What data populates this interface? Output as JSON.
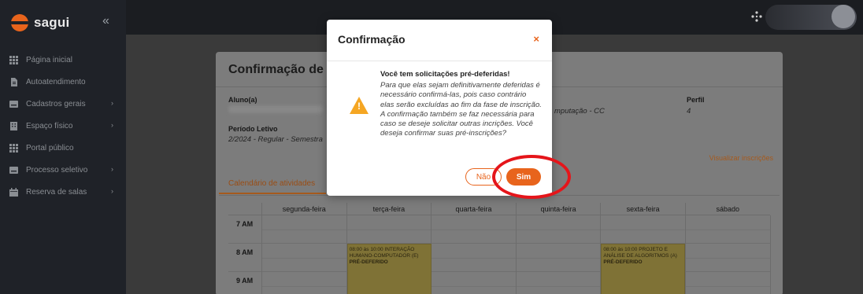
{
  "app": {
    "brand": "sagui"
  },
  "sidebar": {
    "collapse_glyph": "«",
    "items": [
      {
        "label": "Página inicial",
        "icon": "grid-icon",
        "has_chevron": false
      },
      {
        "label": "Autoatendimento",
        "icon": "document-icon",
        "has_chevron": false
      },
      {
        "label": "Cadastros gerais",
        "icon": "card-icon",
        "has_chevron": true
      },
      {
        "label": "Espaço físico",
        "icon": "building-icon",
        "has_chevron": true
      },
      {
        "label": "Portal público",
        "icon": "grid-icon",
        "has_chevron": false
      },
      {
        "label": "Processo seletivo",
        "icon": "card-icon",
        "has_chevron": true
      },
      {
        "label": "Reserva de salas",
        "icon": "calendar-icon",
        "has_chevron": true
      }
    ]
  },
  "topbar": {
    "icons": [
      "network-icon",
      "chart-icon"
    ]
  },
  "page": {
    "title": "Confirmação de sol",
    "aluno_label": "Aluno(a)",
    "curso_value": "mputação - CC",
    "perfil_label": "Perfil",
    "perfil_value": "4",
    "periodo_label": "Período Letivo",
    "periodo_value": "2/2024 - Regular - Semestra",
    "link": "Visualizar inscrições",
    "tab": "Calendário de atividades"
  },
  "calendar": {
    "days": [
      "segunda-feira",
      "terça-feira",
      "quarta-feira",
      "quinta-feira",
      "sexta-feira",
      "sábado"
    ],
    "times": [
      "7 AM",
      "8 AM",
      "9 AM"
    ],
    "events": [
      {
        "day_index": 1,
        "time": "08:00 às 10:00",
        "name": "INTERAÇÃO HUMANO-COMPUTADOR (E)",
        "status": "PRÉ-DEFERIDO"
      },
      {
        "day_index": 4,
        "time": "08:00 às 10:00",
        "name": "PROJETO E ANÁLISE DE ALGORITMOS (A)",
        "status": "PRÉ-DEFERIDO"
      }
    ]
  },
  "modal": {
    "title": "Confirmação",
    "close": "×",
    "heading": "Você tem solicitações pré-deferidas!",
    "body": "Para que elas sejam definitivamente deferidas é necessário confirmá-las, pois caso contrário elas serão excluídas ao fim da fase de inscrição. A confirmação também se faz necessária para caso se deseje solicitar outras incrições. Você deseja confirmar suas pré-inscrições?",
    "no_label": "Não",
    "yes_label": "Sim",
    "warning_mark": "!",
    "accent_color": "#e8641c",
    "highlight_color": "#e5151a"
  }
}
